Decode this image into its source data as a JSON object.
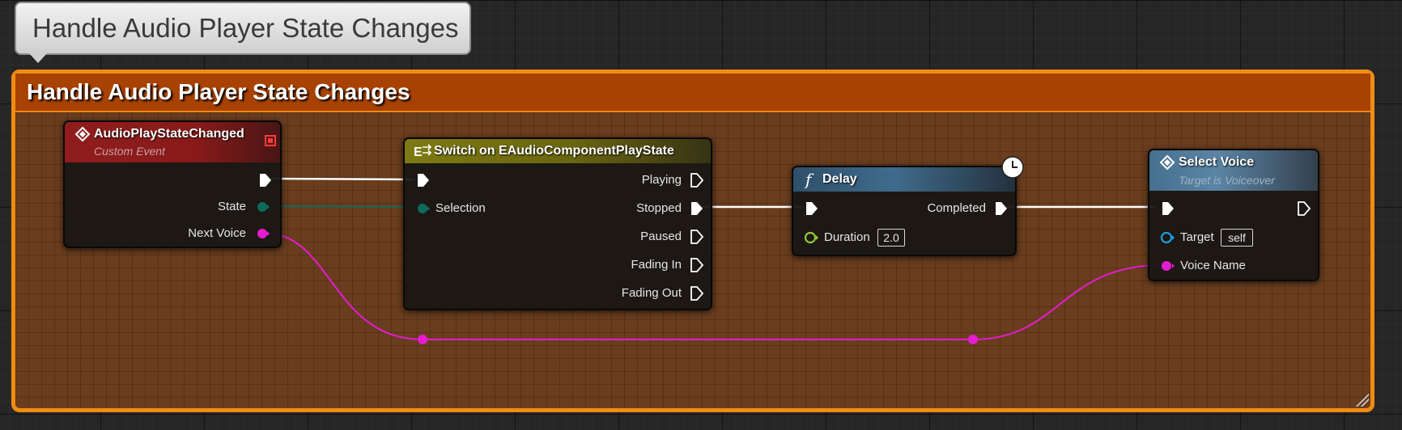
{
  "bubble": {
    "text": "Handle Audio Player State Changes"
  },
  "comment": {
    "title": "Handle Audio Player State Changes",
    "color": "#f08c12",
    "header_color": "#a74202"
  },
  "nodes": {
    "custom_event": {
      "title": "AudioPlayStateChanged",
      "subtitle": "Custom Event",
      "icon": "event-diamond-icon",
      "pins": {
        "state": "State",
        "next_voice": "Next Voice"
      }
    },
    "switch": {
      "title": "Switch on EAudioComponentPlayState",
      "icon": "switch-enum-icon",
      "pins": {
        "selection": "Selection",
        "outputs": [
          "Playing",
          "Stopped",
          "Paused",
          "Fading In",
          "Fading Out"
        ]
      }
    },
    "delay": {
      "title": "Delay",
      "icon": "function-f-icon",
      "pins": {
        "completed": "Completed",
        "duration": "Duration"
      },
      "duration_value": "2.0"
    },
    "select_voice": {
      "title": "Select Voice",
      "subtitle": "Target is Voiceover",
      "icon": "function-diamond-icon",
      "pins": {
        "target": "Target",
        "voice_name": "Voice Name"
      },
      "target_value": "self"
    }
  },
  "colors": {
    "exec_wire": "#ffffff",
    "enum_pin": "#0e6b5c",
    "name_pin": "#e61bd1",
    "object_pin": "#1b9fe0",
    "float_pin": "#92c93b"
  }
}
